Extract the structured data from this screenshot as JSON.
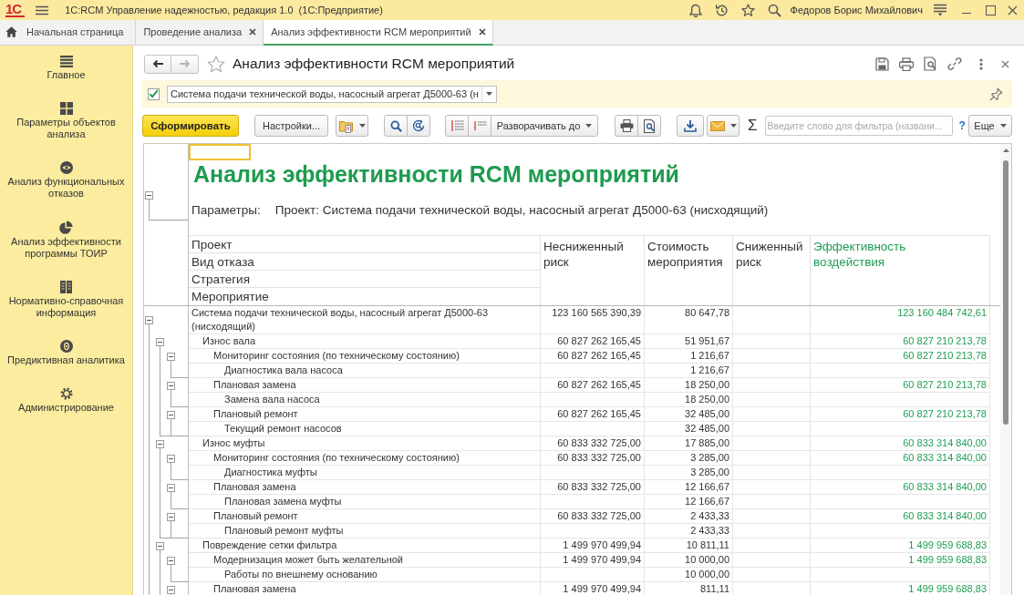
{
  "title_bar": {
    "logo": "1С",
    "title": "1С:RCM Управление надежностью, редакция 1.0  (1С:Предприятие)",
    "user": "Федоров Борис Михайлович"
  },
  "tabs": [
    {
      "label": "Начальная страница",
      "kind": "home",
      "selected": false
    },
    {
      "label": "Проведение анализа",
      "kind": "closable",
      "selected": false
    },
    {
      "label": "Анализ эффективности RCM мероприятий",
      "kind": "closable",
      "selected": true
    }
  ],
  "sidebar": {
    "items": [
      {
        "label": "Главное",
        "selected": false
      },
      {
        "label": "Параметры объектов анализа",
        "selected": false
      },
      {
        "label": "Анализ функциональных отказов",
        "selected": false
      },
      {
        "label": "Анализ эффективности программы ТОИР",
        "selected": false
      },
      {
        "label": "Нормативно-справочная информация",
        "selected": false
      },
      {
        "label": "Предиктивная аналитика",
        "selected": false
      },
      {
        "label": "Администрирование",
        "selected": false
      }
    ]
  },
  "form": {
    "title": "Анализ эффективности RCM мероприятий",
    "navigation": {
      "back": {
        "disabled": false
      },
      "forward": {
        "disabled": true
      }
    }
  },
  "filter": {
    "checked": true,
    "value": "Система подачи технической воды, насосный агрегат Д5000-63 (н"
  },
  "toolbar": {
    "generate": "Сформировать",
    "settings": "Настройки...",
    "expand_to": "Разворачивать до",
    "sum": "Σ",
    "search": {
      "placeholder": "Введите слово для фильтра (названи..."
    },
    "help": "?",
    "more": "Еще"
  },
  "report": {
    "title": "Анализ эффективности RCM мероприятий",
    "header_expanded": true,
    "parameters_label": "Параметры:",
    "parameters": "Проект: Система подачи технической воды, насосный агрегат Д5000-63 (нисходящий)",
    "grouping": [
      "Проект",
      "Вид отказа",
      "Стратегия",
      "Мероприятие"
    ],
    "columns": [
      {
        "label": "Несниженный риск",
        "color": "#333333"
      },
      {
        "label": "Стоимость мероприятия",
        "color": "#333333"
      },
      {
        "label": "Сниженный риск",
        "color": "#333333"
      },
      {
        "label": "Эффективность воздействия",
        "color": "#1f9d55"
      }
    ],
    "rows": [
      {
        "name": "Система подачи технической воды, насосный агрегат Д5000-63 (нисходящий)",
        "unreduced_risk": "123 160 565 390,39",
        "cost": "80 647,78",
        "effectiveness": "123 160 484 742,61",
        "expanded": true,
        "children": [
          {
            "name": "Износ вала",
            "unreduced_risk": "60 827 262 165,45",
            "cost": "51 951,67",
            "effectiveness": "60 827 210 213,78",
            "expanded": true,
            "children": [
              {
                "name": "Мониторинг состояния (по техническому состоянию)",
                "unreduced_risk": "60 827 262 165,45",
                "cost": "1 216,67",
                "effectiveness": "60 827 210 213,78",
                "expanded": true,
                "children": [
                  {
                    "name": "Диагностика вала насоса",
                    "cost": "1 216,67"
                  }
                ]
              },
              {
                "name": "Плановая замена",
                "unreduced_risk": "60 827 262 165,45",
                "cost": "18 250,00",
                "effectiveness": "60 827 210 213,78",
                "expanded": true,
                "children": [
                  {
                    "name": "Замена вала насоса",
                    "cost": "18 250,00"
                  }
                ]
              },
              {
                "name": "Плановый ремонт",
                "unreduced_risk": "60 827 262 165,45",
                "cost": "32 485,00",
                "effectiveness": "60 827 210 213,78",
                "expanded": true,
                "children": [
                  {
                    "name": "Текущий ремонт насосов",
                    "cost": "32 485,00"
                  }
                ]
              }
            ]
          },
          {
            "name": "Износ муфты",
            "unreduced_risk": "60 833 332 725,00",
            "cost": "17 885,00",
            "effectiveness": "60 833 314 840,00",
            "expanded": true,
            "children": [
              {
                "name": "Мониторинг состояния (по техническому состоянию)",
                "unreduced_risk": "60 833 332 725,00",
                "cost": "3 285,00",
                "effectiveness": "60 833 314 840,00",
                "expanded": true,
                "children": [
                  {
                    "name": "Диагностика муфты",
                    "cost": "3 285,00"
                  }
                ]
              },
              {
                "name": "Плановая замена",
                "unreduced_risk": "60 833 332 725,00",
                "cost": "12 166,67",
                "effectiveness": "60 833 314 840,00",
                "expanded": true,
                "children": [
                  {
                    "name": "Плановая замена муфты",
                    "cost": "12 166,67"
                  }
                ]
              },
              {
                "name": "Плановый ремонт",
                "unreduced_risk": "60 833 332 725,00",
                "cost": "2 433,33",
                "effectiveness": "60 833 314 840,00",
                "expanded": true,
                "children": [
                  {
                    "name": "Плановый ремонт муфты",
                    "cost": "2 433,33"
                  }
                ]
              }
            ]
          },
          {
            "name": "Повреждение сетки фильтра",
            "unreduced_risk": "1 499 970 499,94",
            "cost": "10 811,11",
            "effectiveness": "1 499 959 688,83",
            "expanded": true,
            "children": [
              {
                "name": "Модернизация может быть желательной",
                "unreduced_risk": "1 499 970 499,94",
                "cost": "10 000,00",
                "effectiveness": "1 499 959 688,83",
                "expanded": true,
                "children": [
                  {
                    "name": "Работы по внешнему основанию",
                    "cost": "10 000,00"
                  }
                ]
              },
              {
                "name": "Плановая замена",
                "unreduced_risk": "1 499 970 499,94",
                "cost": "811,11",
                "effectiveness": "1 499 959 688,83",
                "expanded": true
              }
            ]
          }
        ]
      }
    ]
  }
}
